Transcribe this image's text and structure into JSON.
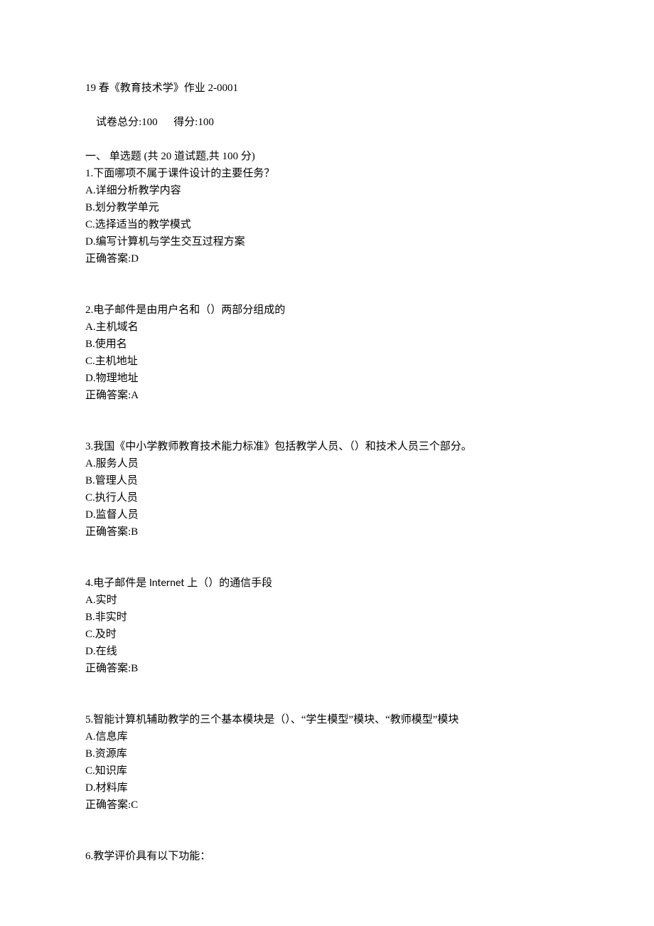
{
  "header": {
    "title": "19 春《教育技术学》作业 2-0001"
  },
  "meta": {
    "total_label": "试卷总分:",
    "total_value": "100",
    "score_label": "得分:",
    "score_value": "100"
  },
  "section": {
    "label": "一、 单选题 (共 20 道试题,共 100 分)"
  },
  "questions": [
    {
      "num": "1.",
      "stem": "下面哪项不属于课件设计的主要任务？",
      "options": [
        {
          "key": "A.",
          "text": "详细分析教学内容"
        },
        {
          "key": "B.",
          "text": "划分教学单元"
        },
        {
          "key": "C.",
          "text": "选择适当的教学模式"
        },
        {
          "key": "D.",
          "text": "编写计算机与学生交互过程方案"
        }
      ],
      "answer_label": "正确答案:",
      "answer": "D"
    },
    {
      "num": "2.",
      "stem": "电子邮件是由用户名和（）两部分组成的",
      "options": [
        {
          "key": "A.",
          "text": "主机域名"
        },
        {
          "key": "B.",
          "text": "使用名"
        },
        {
          "key": "C.",
          "text": "主机地址"
        },
        {
          "key": "D.",
          "text": "物理地址"
        }
      ],
      "answer_label": "正确答案:",
      "answer": "A"
    },
    {
      "num": "3.",
      "stem": "我国《中小学教师教育技术能力标准》包括教学人员、（）和技术人员三个部分。",
      "options": [
        {
          "key": "A.",
          "text": "服务人员"
        },
        {
          "key": "B.",
          "text": "管理人员"
        },
        {
          "key": "C.",
          "text": "执行人员"
        },
        {
          "key": "D.",
          "text": "监督人员"
        }
      ],
      "answer_label": "正确答案:",
      "answer": "B"
    },
    {
      "num": "4.",
      "stem_pre": "电子邮件是 ",
      "stem_internet": "Internet",
      "stem_post": " 上（）的通信手段",
      "stem": "电子邮件是 Internet 上（）的通信手段",
      "options": [
        {
          "key": "A.",
          "text": "实时"
        },
        {
          "key": "B.",
          "text": "非实时"
        },
        {
          "key": "C.",
          "text": "及时"
        },
        {
          "key": "D.",
          "text": "在线"
        }
      ],
      "answer_label": "正确答案:",
      "answer": "B"
    },
    {
      "num": "5.",
      "stem": "智能计算机辅助教学的三个基本模块是（）、“学生模型”模块、“教师模型”模块",
      "options": [
        {
          "key": "A.",
          "text": "信息库"
        },
        {
          "key": "B.",
          "text": "资源库"
        },
        {
          "key": "C.",
          "text": "知识库"
        },
        {
          "key": "D.",
          "text": "材料库"
        }
      ],
      "answer_label": "正确答案:",
      "answer": "C"
    },
    {
      "num": "6.",
      "stem": "教学评价具有以下功能："
    }
  ]
}
